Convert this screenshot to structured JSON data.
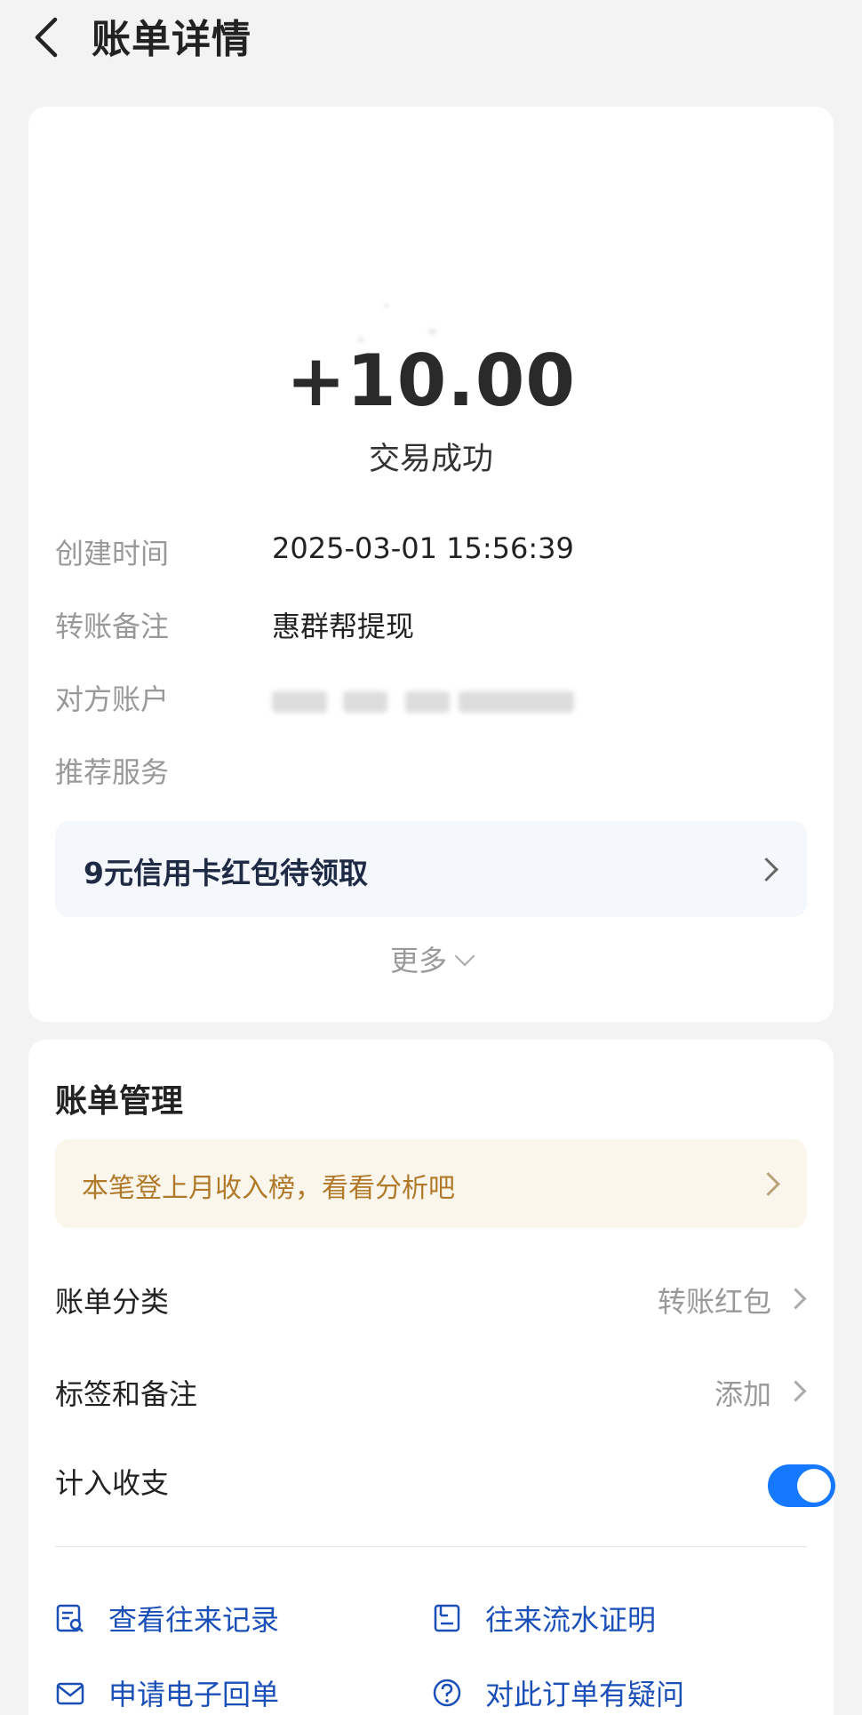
{
  "header": {
    "title": "账单详情"
  },
  "transaction": {
    "amount": "+10.00",
    "status": "交易成功"
  },
  "details": [
    {
      "label": "创建时间",
      "value": "2025-03-01 15:56:39"
    },
    {
      "label": "转账备注",
      "value": "惠群帮提现"
    },
    {
      "label": "对方账户",
      "value": ""
    },
    {
      "label": "推荐服务",
      "value": ""
    }
  ],
  "promo": {
    "text": "9元信用卡红包待领取"
  },
  "more": {
    "label": "更多"
  },
  "management": {
    "title": "账单管理",
    "notice": "本笔登上月收入榜，看看分析吧",
    "category_label": "账单分类",
    "category_value": "转账红包",
    "tags_label": "标签和备注",
    "tags_value": "添加",
    "include_label": "计入收支",
    "include_enabled": true
  },
  "actions": [
    {
      "label": "查看往来记录",
      "icon": "record-search-icon"
    },
    {
      "label": "往来流水证明",
      "icon": "statement-doc-icon"
    },
    {
      "label": "申请电子回单",
      "icon": "mail-icon"
    },
    {
      "label": "对此订单有疑问",
      "icon": "question-icon"
    }
  ],
  "colors": {
    "accent": "#1677ff",
    "action_text": "#1a4fb8",
    "notice_text": "#b07a2a"
  }
}
